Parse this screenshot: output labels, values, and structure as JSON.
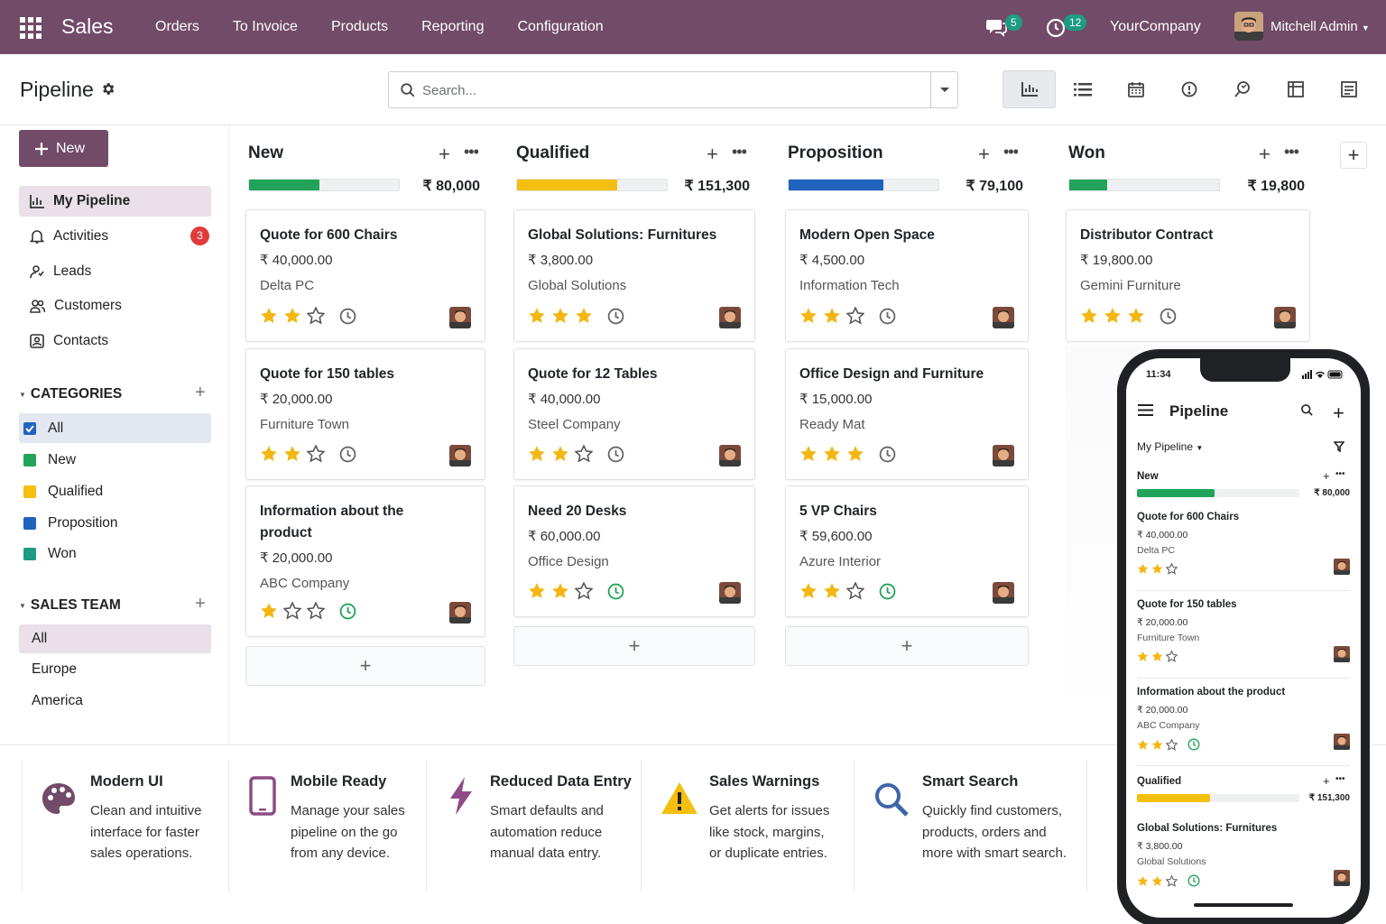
{
  "topbar": {
    "app_name": "Sales",
    "nav": [
      "Orders",
      "To Invoice",
      "Products",
      "Reporting",
      "Configuration"
    ],
    "messages_count": "5",
    "activities_count": "12",
    "company": "YourCompany",
    "user": "Mitchell Admin"
  },
  "colors": {
    "brand": "#714b67",
    "new": "#21a35a",
    "qualified": "#f5bf0f",
    "proposition": "#1f63bd",
    "won": "#21a35a",
    "star": "#f3b613"
  },
  "control": {
    "title": "Pipeline",
    "search_placeholder": "Search..."
  },
  "sidebar": {
    "new_button": "New",
    "items": [
      {
        "label": "My Pipeline",
        "icon": "chart-icon"
      },
      {
        "label": "Activities",
        "icon": "bell-icon",
        "badge": "3"
      },
      {
        "label": "Leads",
        "icon": "leads-icon"
      },
      {
        "label": "Customers",
        "icon": "users-icon"
      },
      {
        "label": "Contacts",
        "icon": "contact-card-icon"
      }
    ],
    "categories_title": "CATEGORIES",
    "categories": [
      "All",
      "New",
      "Qualified",
      "Proposition",
      "Won"
    ],
    "sales_team_title": "SALES TEAM",
    "teams": [
      "All",
      "Europe",
      "America"
    ]
  },
  "columns": [
    {
      "name": "New",
      "total": "₹ 80,000",
      "progress": 0.47,
      "cards": [
        {
          "title": "Quote for 600 Chairs",
          "revenue": "₹ 40,000.00",
          "company": "Delta PC",
          "stars": 2
        },
        {
          "title": "Quote for 150 tables",
          "revenue": "₹ 20,000.00",
          "company": "Furniture Town",
          "stars": 2
        },
        {
          "title": "Information about the product",
          "revenue": "₹ 20,000.00",
          "company": "ABC Company",
          "stars": 1
        }
      ]
    },
    {
      "name": "Qualified",
      "total": "₹ 151,300",
      "progress": 0.67,
      "cards": [
        {
          "title": "Global Solutions: Furnitures",
          "revenue": "₹ 3,800.00",
          "company": "Global Solutions",
          "stars": 3
        },
        {
          "title": "Quote for 12 Tables",
          "revenue": "₹ 40,000.00",
          "company": "Steel Company",
          "stars": 2
        },
        {
          "title": "Need 20 Desks",
          "revenue": "₹ 60,000.00",
          "company": "Office Design",
          "stars": 2
        }
      ]
    },
    {
      "name": "Proposition",
      "total": "₹ 79,100",
      "progress": 0.63,
      "cards": [
        {
          "title": "Modern Open Space",
          "revenue": "₹ 4,500.00",
          "company": "Information Tech",
          "stars": 2
        },
        {
          "title": "Office Design and Furniture",
          "revenue": "₹ 15,000.00",
          "company": "Ready Mat",
          "stars": 3
        },
        {
          "title": "5 VP Chairs",
          "revenue": "₹ 59,600.00",
          "company": "Azure Interior",
          "stars": 2
        }
      ]
    },
    {
      "name": "Won",
      "total": "₹ 19,800",
      "progress": 0.25,
      "cards": [
        {
          "title": "Distributor Contract",
          "revenue": "₹ 19,800.00",
          "company": "Gemini Furniture",
          "stars": 3
        }
      ]
    }
  ],
  "features": [
    {
      "title": "Modern UI",
      "lines": [
        "Clean and intuitive",
        "interface for faster",
        "sales operations."
      ],
      "icon": "palette-icon",
      "color": "#714b67"
    },
    {
      "title": "Mobile Ready",
      "lines": [
        "Manage your sales",
        "pipeline on the go",
        "from any device."
      ],
      "icon": "mobile-icon",
      "color": "#8e4b86"
    },
    {
      "title": "Reduced Data Entry",
      "lines": [
        "Smart defaults and",
        "automation reduce",
        "manual data entry."
      ],
      "icon": "bolt-icon",
      "color": "#8e4b86"
    },
    {
      "title": "Sales Warnings",
      "lines": [
        "Get alerts for issues",
        "like stock, margins,",
        "or duplicate entries."
      ],
      "icon": "warning-icon",
      "color": "#f5bf0f"
    },
    {
      "title": "Smart Search",
      "lines": [
        "Quickly find customers,",
        "products, orders and",
        "more with smart search."
      ],
      "icon": "search-icon",
      "color": "#3f66a8"
    }
  ],
  "phone": {
    "time": "11:34",
    "title": "Pipeline",
    "filter": "My Pipeline",
    "col1": {
      "name": "New",
      "total": "₹ 80,000"
    },
    "cards1": [
      {
        "title": "Quote for 600 Chairs",
        "revenue": "₹ 40,000.00",
        "company": "Delta PC"
      },
      {
        "title": "Quote for 150 tables",
        "revenue": "₹ 20,000.00",
        "company": "Furniture Town"
      },
      {
        "title": "Information about the product",
        "revenue": "₹ 20,000.00",
        "company": "ABC Company"
      }
    ],
    "col2": {
      "name": "Qualified",
      "total": "₹ 151,300"
    },
    "cards2": [
      {
        "title": "Global Solutions: Furnitures",
        "revenue": "₹ 3,800.00",
        "company": "Global Solutions"
      }
    ]
  }
}
